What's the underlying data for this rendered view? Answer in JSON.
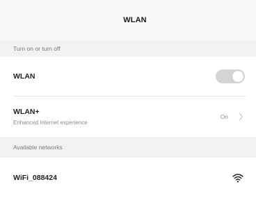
{
  "header": {
    "title": "WLAN"
  },
  "sections": {
    "toggle_section": "Turn on or turn off",
    "networks_section": "Available networks"
  },
  "wlan_row": {
    "label": "WLAN",
    "switch_state": "on"
  },
  "wlan_plus_row": {
    "label": "WLAN+",
    "subtitle": "Enhanced Internet experience",
    "value": "On",
    "icon": "chevron-right-icon"
  },
  "networks": [
    {
      "name": "WiFi_088424",
      "icon": "wifi-signal-icon"
    }
  ]
}
